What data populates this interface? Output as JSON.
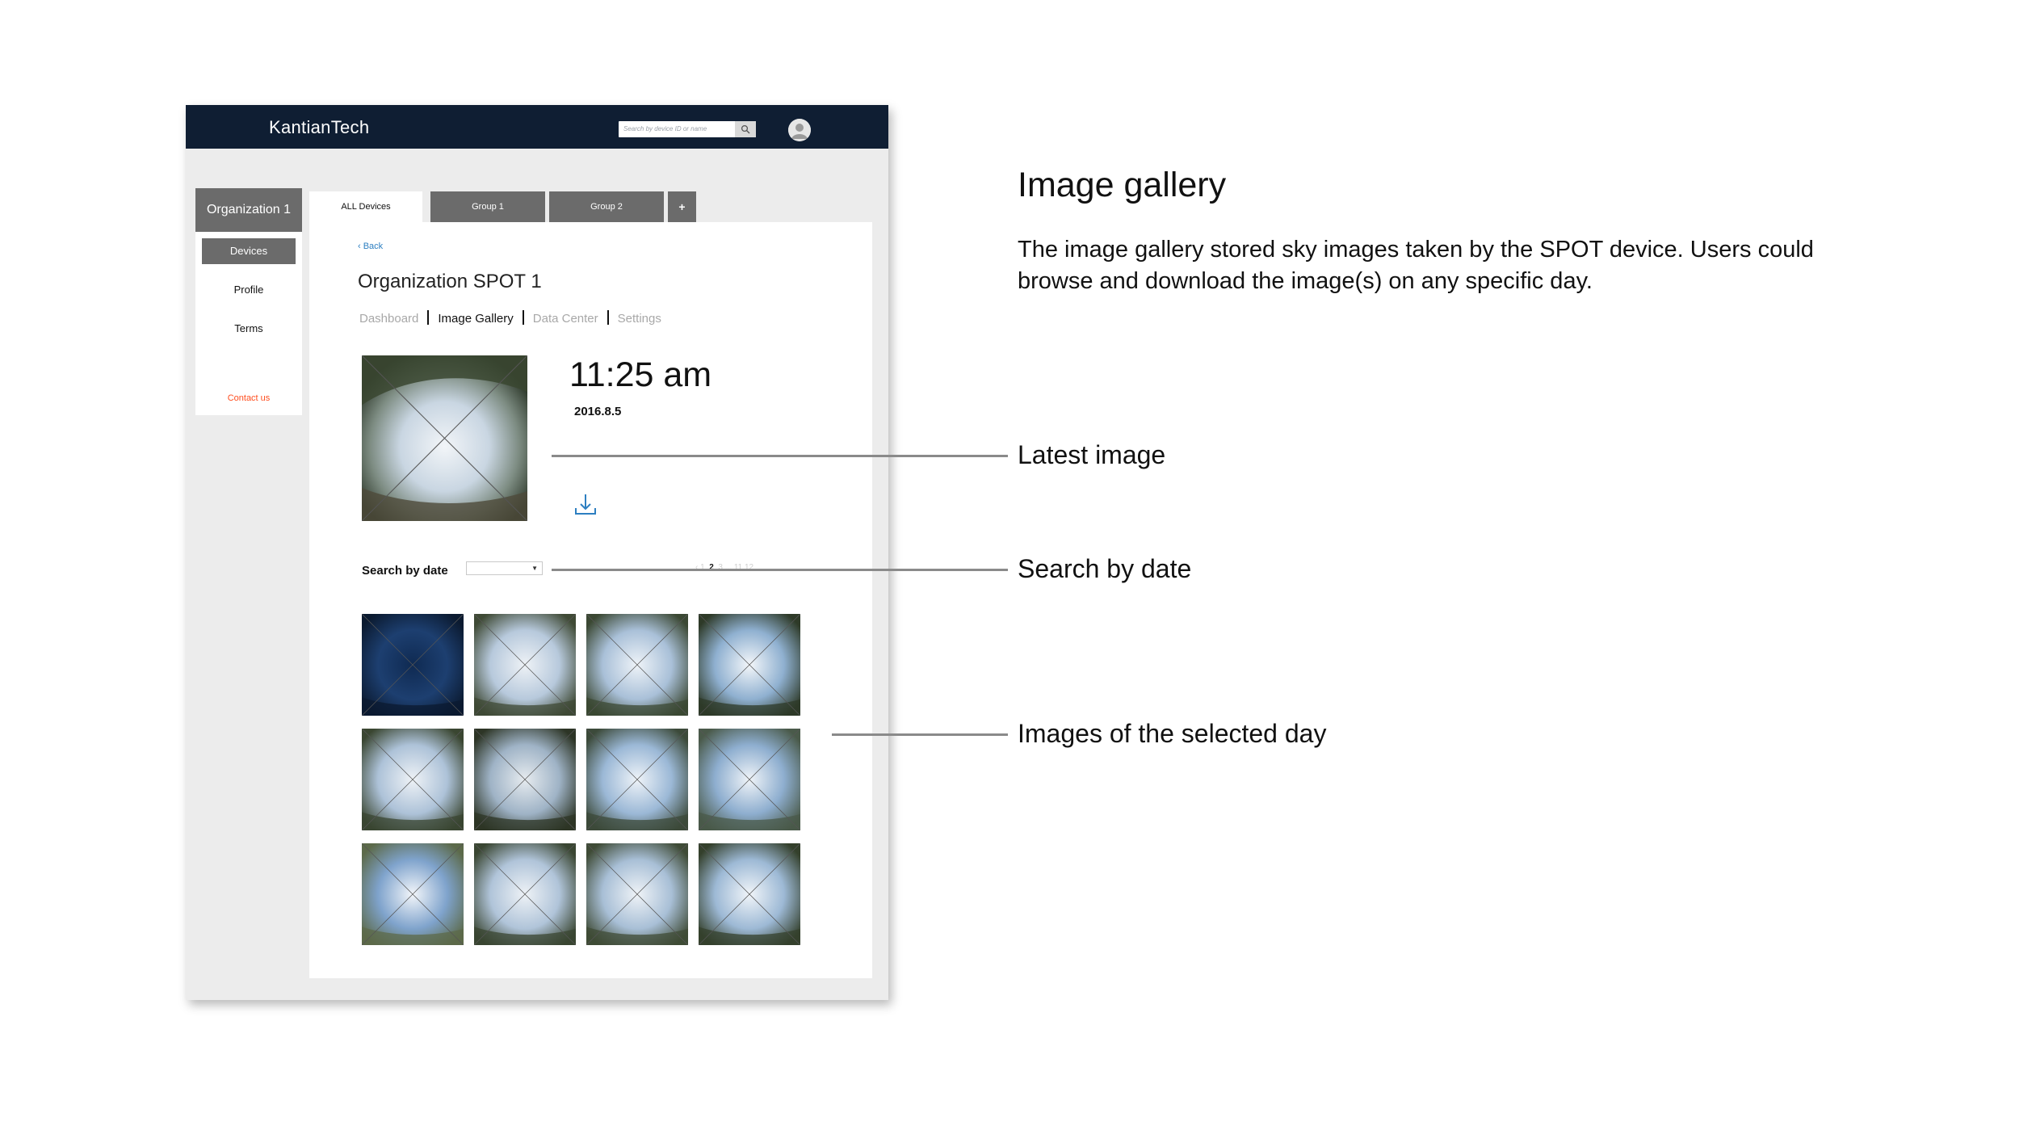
{
  "app": {
    "brand": "KantianTech",
    "search_placeholder": "Search by device ID or name"
  },
  "sidebar": {
    "organization": "Organization 1",
    "items": [
      {
        "label": "Devices",
        "active": true
      },
      {
        "label": "Profile",
        "active": false
      },
      {
        "label": "Terms",
        "active": false
      }
    ],
    "contact": "Contact us"
  },
  "tabs": [
    {
      "label": "ALL Devices",
      "active": true
    },
    {
      "label": "Group 1",
      "active": false
    },
    {
      "label": "Group 2",
      "active": false
    },
    {
      "label": "+",
      "active": false
    }
  ],
  "content": {
    "back": "‹ Back",
    "title": "Organization SPOT 1",
    "subnav": [
      {
        "label": "Dashboard",
        "active": false
      },
      {
        "label": "Image Gallery",
        "active": true
      },
      {
        "label": "Data Center",
        "active": false
      },
      {
        "label": "Settings",
        "active": false
      }
    ],
    "latest": {
      "time": "11:25 am",
      "date": "2016.8.5"
    },
    "search_by_date": "Search by date",
    "pager": {
      "prev": "‹ 1",
      "current": "2",
      "rest": "3 ... 11 12"
    }
  },
  "annotations": {
    "title": "Image gallery",
    "description": "The image gallery stored sky images taken by the SPOT device. Users could browse and download the image(s) on any specific day.",
    "latest_image": "Latest image",
    "search_by_date": "Search by date",
    "images_of_day": "Images of the selected day"
  },
  "colors": {
    "topbar": "#0f1e33",
    "sidebar_active": "#6b6b6b",
    "link": "#2d7fc1",
    "contact": "#ff4e1f"
  }
}
